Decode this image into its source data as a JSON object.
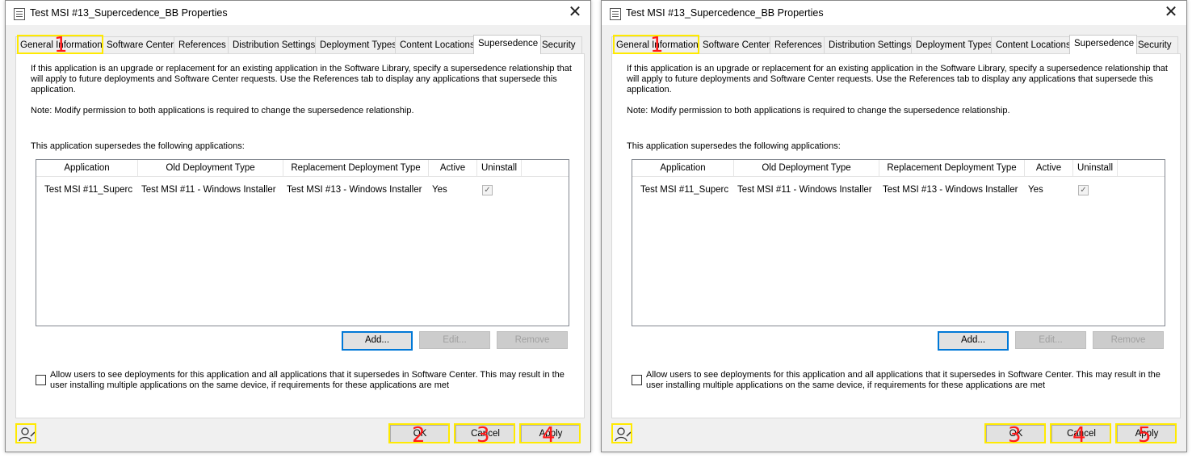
{
  "dialogs": [
    {
      "title": "Test MSI #13_Supercedence_BB Properties",
      "tabs": [
        "General Information",
        "Software Center",
        "References",
        "Distribution Settings",
        "Deployment Types",
        "Content Locations",
        "Supersedence",
        "Security"
      ],
      "active_tab": "Supersedence",
      "intro": "If this application is an upgrade or replacement for an existing application in the Software Library, specify a supersedence relationship that will apply to future deployments and Software Center requests. Use the References tab to display any applications that supersede this application.",
      "note": "Note: Modify permission to both applications is required to change the supersedence relationship.",
      "list_caption": "This application supersedes the following applications:",
      "columns": [
        "Application",
        "Old Deployment Type",
        "Replacement Deployment Type",
        "Active",
        "Uninstall"
      ],
      "rows": [
        {
          "application": "Test MSI #11_Superc",
          "old": "Test MSI #11 - Windows Installer (",
          "replacement": "Test MSI #13 - Windows Installer (",
          "active": "Yes",
          "uninstall_checked": true
        }
      ],
      "add_label": "Add...",
      "edit_label": "Edit...",
      "remove_label": "Remove",
      "allow_label": "Allow users to see deployments for this application and all applications that it supersedes in Software Center. This may result in the user installing multiple applications on the same device, if requirements for these applications are met",
      "ok_label": "OK",
      "cancel_label": "Cancel",
      "apply_label": "Apply",
      "markers": {
        "tab": "1",
        "ok": "2",
        "cancel": "3",
        "apply": "4"
      }
    },
    {
      "title": "Test MSI #13_Supercedence_BB Properties",
      "tabs": [
        "General Information",
        "Software Center",
        "References",
        "Distribution Settings",
        "Deployment Types",
        "Content Locations",
        "Supersedence",
        "Security"
      ],
      "active_tab": "Supersedence",
      "intro": "If this application is an upgrade or replacement for an existing application in the Software Library, specify a supersedence relationship that will apply to future deployments and Software Center requests. Use the References tab to display any applications that supersede this application.",
      "note": "Note: Modify permission to both applications is required to change the supersedence relationship.",
      "list_caption": "This application supersedes the following applications:",
      "columns": [
        "Application",
        "Old Deployment Type",
        "Replacement Deployment Type",
        "Active",
        "Uninstall"
      ],
      "rows": [
        {
          "application": "Test MSI #11_Superc",
          "old": "Test MSI #11 - Windows Installer (",
          "replacement": "Test MSI #13 - Windows Installer (",
          "active": "Yes",
          "uninstall_checked": true
        }
      ],
      "add_label": "Add...",
      "edit_label": "Edit...",
      "remove_label": "Remove",
      "allow_label": "Allow users to see deployments for this application and all applications that it supersedes in Software Center. This may result in the user installing multiple applications on the same device, if requirements for these applications are met",
      "ok_label": "OK",
      "cancel_label": "Cancel",
      "apply_label": "Apply",
      "markers": {
        "tab": "1",
        "ok": "3",
        "cancel": "4",
        "apply": "5"
      }
    }
  ],
  "highlight_color": "#ffea00",
  "marker_color": "#ff1a1a",
  "accent_color": "#0078d7"
}
